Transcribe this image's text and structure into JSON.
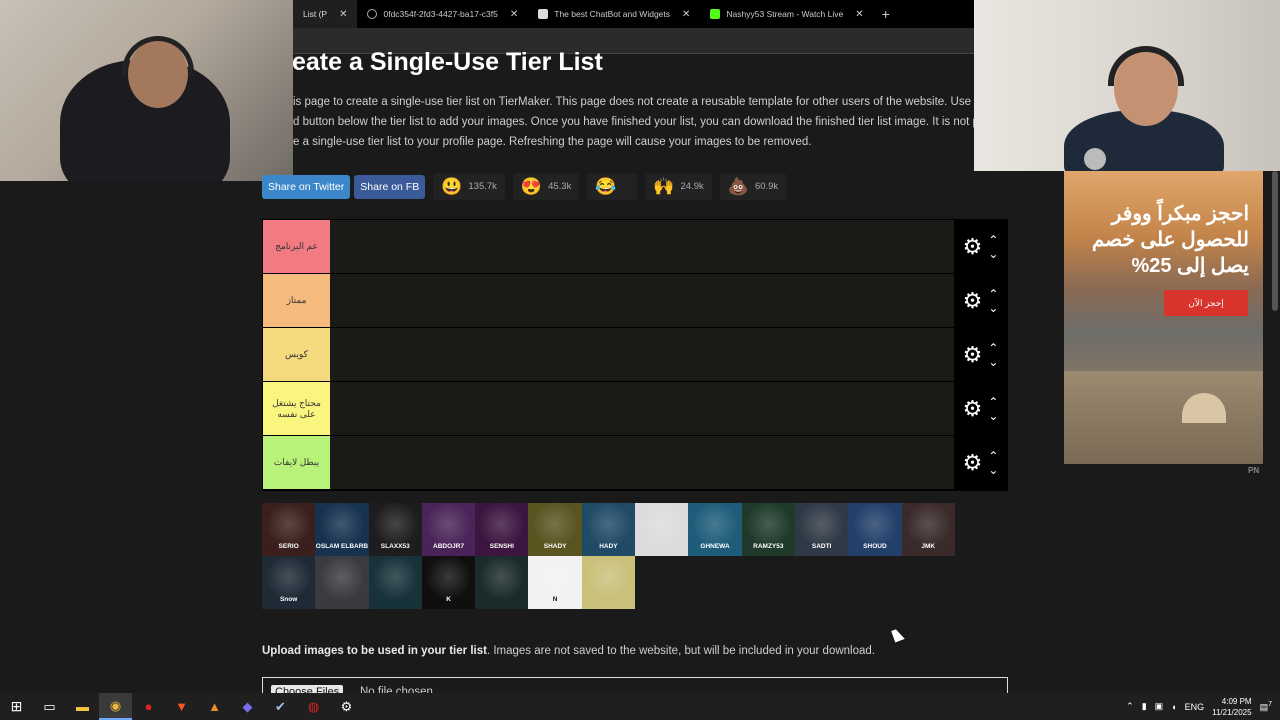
{
  "browser": {
    "tabs": [
      {
        "label": "List (P",
        "active": true
      },
      {
        "label": "0fdc354f-2fd3-4427-ba17-c3f5",
        "active": false
      },
      {
        "label": "The best ChatBot and Widgets",
        "active": false
      },
      {
        "label": "Nashyy53 Stream - Watch Live",
        "active": false
      }
    ],
    "new_tab": "+",
    "close_glyph": "✕"
  },
  "page": {
    "title": "eate a Single-Use Tier List",
    "description_lines": [
      "is page to create a single-use tier list on TierMaker. This page does not create a reusable template for other users of the website. Use th",
      "d button below the tier list to add your images. Once you have finished your list, you can download the finished tier list image. It is not po",
      "e a single-use tier list to your profile page. Refreshing the page will cause your images to be removed."
    ]
  },
  "share": {
    "twitter": "Share on Twitter",
    "facebook": "Share on FB",
    "reactions": [
      {
        "emoji": "😃",
        "count": "135.7k"
      },
      {
        "emoji": "😍",
        "count": "45.3k"
      },
      {
        "emoji": "😂",
        "count": ""
      },
      {
        "emoji": "🙌",
        "count": "24.9k"
      },
      {
        "emoji": "💩",
        "count": "60.9k"
      }
    ]
  },
  "tiers": [
    {
      "label": "عم البرنامج",
      "color": "#f27a81"
    },
    {
      "label": "ممتاز",
      "color": "#f5bb7d"
    },
    {
      "label": "كويس",
      "color": "#f4da7c"
    },
    {
      "label": "محتاج يشتغل على نفسه",
      "color": "#faf57f"
    },
    {
      "label": "يبطل لايفات",
      "color": "#b8f279"
    }
  ],
  "tier_controls": {
    "gear": "⚙",
    "up": "⌃",
    "down": "⌄"
  },
  "pool": [
    {
      "caption": "SERIO",
      "color": "#3a1f1c"
    },
    {
      "caption": "OSLAM ELBARB",
      "color": "#16324f"
    },
    {
      "caption": "SLAXX53",
      "color": "#1d1d1d"
    },
    {
      "caption": "ABDOJR7",
      "color": "#4a2458"
    },
    {
      "caption": "SENSHI",
      "color": "#3c1640"
    },
    {
      "caption": "SHADY",
      "color": "#5a5420"
    },
    {
      "caption": "HADY",
      "color": "#204a66"
    },
    {
      "caption": "",
      "color": "#dcdcdc"
    },
    {
      "caption": "GHNEWA",
      "color": "#1f5c7a"
    },
    {
      "caption": "RAMZY53",
      "color": "#1f3a2a"
    },
    {
      "caption": "SADTI",
      "color": "#303a46"
    },
    {
      "caption": "SHOUD",
      "color": "#23406a"
    },
    {
      "caption": "JMK",
      "color": "#3a2a2a"
    },
    {
      "caption": "Snow",
      "color": "#1e2a36"
    },
    {
      "caption": "",
      "color": "#3a3a40"
    },
    {
      "caption": "",
      "color": "#18323a"
    },
    {
      "caption": "K",
      "color": "#0f0f0f"
    },
    {
      "caption": "",
      "color": "#1b2b2b"
    },
    {
      "caption": "N",
      "color": "#f2f2f2"
    },
    {
      "caption": "",
      "color": "#c9c07a"
    }
  ],
  "upload": {
    "bold": "Upload images to be used in your tier list",
    "rest": ". Images are not saved to the website, but will be included in your download.",
    "button": "Choose Files",
    "no_file": "No file chosen"
  },
  "ad": {
    "headline": "احجز مبكراً ووفر للحصول على خصم يصل إلى 25%",
    "cta": "إحجز الآن",
    "tag": "PN"
  },
  "taskbar": {
    "lang": "ENG",
    "time": "4:09 PM",
    "date": "11/21/2025",
    "notifications": "7"
  }
}
